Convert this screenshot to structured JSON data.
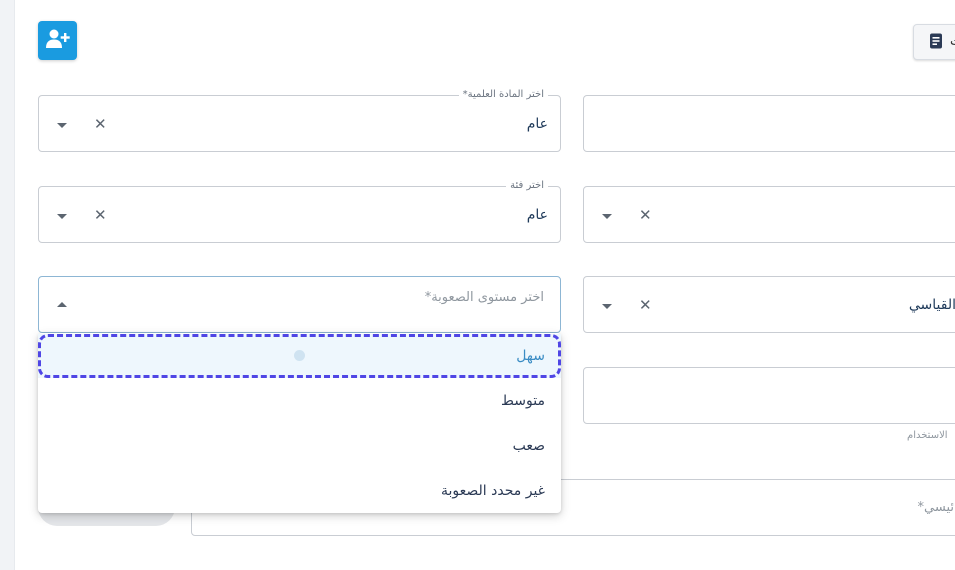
{
  "toolbar": {
    "add_user_icon": "add-user-icon",
    "document_icon": "document-icon",
    "document_button_partial": "ت",
    "accent": "#1a9be0"
  },
  "form": {
    "subject": {
      "label": "اختر المادة العلمية*",
      "value": "عام"
    },
    "category": {
      "label": "اختر فئة",
      "value": "عام"
    },
    "difficulty": {
      "placeholder": "اختر مستوى الصعوبة*",
      "options": [
        "سهل",
        "متوسط",
        "صعب",
        "غير محدد الصعوبة"
      ]
    },
    "right_column": {
      "measurement_value": "القياسي",
      "usage_helper": "الاستخدام",
      "bottom_placeholder": "ئيسي*"
    }
  },
  "focus_color": "#4f46e5"
}
